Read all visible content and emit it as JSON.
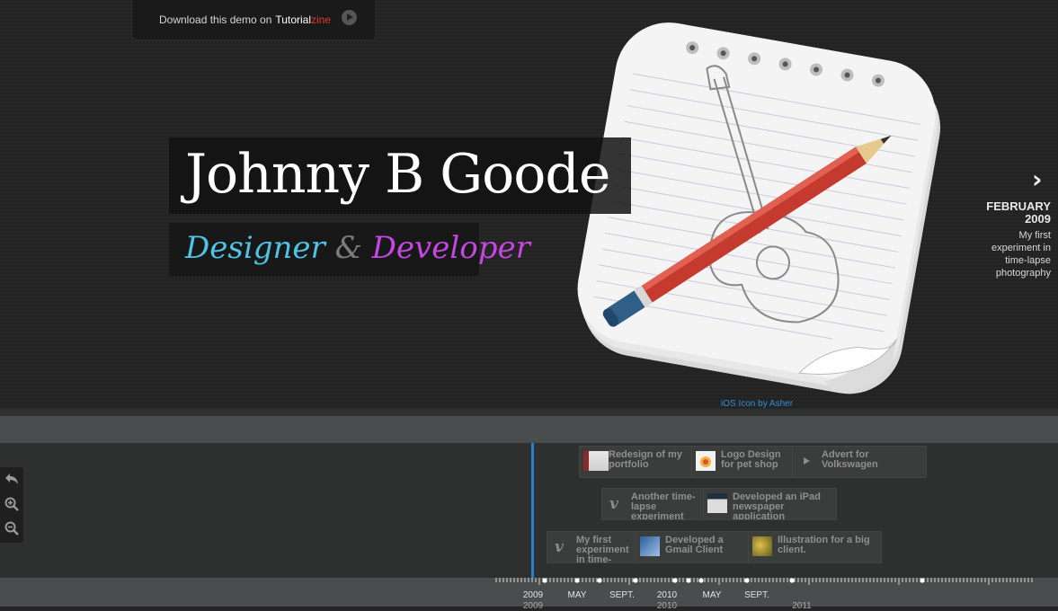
{
  "download_bar": {
    "text": "Download this demo on",
    "brand_main": "Tutorial",
    "brand_accent": "zine"
  },
  "hero": {
    "title": "Johnny B Goode",
    "subtitle_part1": "Designer",
    "subtitle_amp": "&",
    "subtitle_part2": "Developer",
    "icon_credit": "iOS Icon by Asher"
  },
  "next_nav": {
    "arrow": "›",
    "date_month": "FEBRUARY",
    "date_year": "2009",
    "description": "My first experiment in time-lapse photography"
  },
  "events": [
    {
      "title": "Redesign of my portfolio",
      "thumb": "image"
    },
    {
      "title": "Logo Design for pet shop",
      "thumb": "image"
    },
    {
      "title": "Advert for Volkswagen",
      "thumb": "video"
    },
    {
      "title": "Another time-lapse experiment",
      "thumb": "vimeo"
    },
    {
      "title": "Developed an iPad newspaper application",
      "thumb": "image"
    },
    {
      "title": "My first experiment in time-lapse photography",
      "thumb": "vimeo"
    },
    {
      "title": "Developed a Gmail Client",
      "thumb": "image"
    },
    {
      "title": "Illustration for a big client.",
      "thumb": "image"
    }
  ],
  "ruler": {
    "labels": [
      "2009",
      "MAY",
      "SEPT.",
      "2010",
      "MAY",
      "SEPT."
    ],
    "sub_labels": [
      "2009",
      "2010",
      "2011"
    ]
  },
  "zoom": {
    "back_icon": "back-icon",
    "zoom_in_icon": "zoom-in-icon",
    "zoom_out_icon": "zoom-out-icon"
  },
  "colors": {
    "accent_blue": "#2a7fd2",
    "subtitle_cyan": "#4fc3e4",
    "subtitle_purple": "#c347e0",
    "brand_red": "#e0382f"
  }
}
